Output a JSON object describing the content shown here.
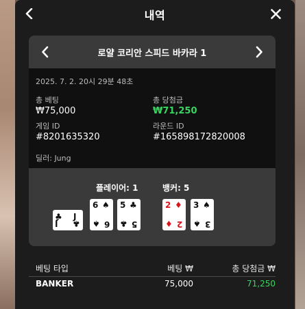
{
  "header": {
    "title": "내역"
  },
  "game": {
    "title": "로얄 코리안 스피드 바카라 1"
  },
  "info": {
    "datetime": "2025. 7. 2. 20시 29분 48초",
    "total_bet_label": "총 베팅",
    "total_bet_value": "₩75,000",
    "total_win_label": "총 당첨금",
    "total_win_value": "₩71,250",
    "game_id_label": "게임 ID",
    "game_id_value": "#8201635320",
    "round_id_label": "라운드 ID",
    "round_id_value": "#165898172820008",
    "dealer": "딜러: Jung"
  },
  "results": {
    "player_label": "플레이어: 1",
    "banker_label": "뱅커: 5",
    "player_cards": [
      {
        "rank": "J",
        "suit": "♣",
        "color": "black",
        "rotated": true
      },
      {
        "rank": "6",
        "suit": "♠",
        "color": "black",
        "rotated": false
      },
      {
        "rank": "5",
        "suit": "♣",
        "color": "black",
        "rotated": false
      }
    ],
    "banker_cards": [
      {
        "rank": "2",
        "suit": "♦",
        "color": "red",
        "rotated": false
      },
      {
        "rank": "3",
        "suit": "♠",
        "color": "black",
        "rotated": false
      }
    ]
  },
  "table": {
    "headers": [
      "베팅 타입",
      "베팅 ₩",
      "총 당첨금 ₩"
    ],
    "rows": [
      {
        "type": "BANKER",
        "bet": "75,000",
        "win": "71,250"
      }
    ]
  },
  "colors": {
    "accent_green": "#3bd461",
    "card_red": "#d8141c",
    "panel": "#1c1c1c"
  },
  "icons": {
    "back": "chevron-left-icon",
    "close": "close-icon",
    "prev": "chevron-left-icon",
    "next": "chevron-right-icon"
  }
}
